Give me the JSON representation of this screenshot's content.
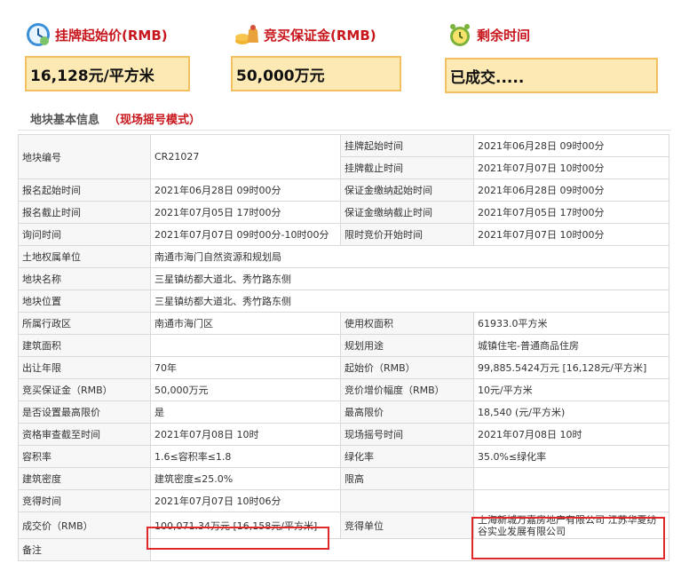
{
  "summary": {
    "start_price": {
      "label": "挂牌起始价(RMB)",
      "value": "16,128元/平方米",
      "icon": "clock-money-icon"
    },
    "deposit": {
      "label": "竞买保证金(RMB)",
      "value": "50,000万元",
      "icon": "coins-bag-icon"
    },
    "remaining": {
      "label": "剩余时间",
      "value": "已成交.....",
      "icon": "alarm-clock-icon"
    }
  },
  "section": {
    "title": "地块基本信息",
    "mode": "（现场摇号模式）"
  },
  "table": {
    "r0": {
      "k1": "地块编号",
      "v1": "CR21027",
      "k2a": "挂牌起始时间",
      "v2a": "2021年06月28日 09时00分",
      "k2b": "挂牌截止时间",
      "v2b": "2021年07月07日 10时00分"
    },
    "r1": {
      "k1": "报名起始时间",
      "v1": "2021年06月28日 09时00分",
      "k2": "保证金缴纳起始时间",
      "v2": "2021年06月28日 09时00分"
    },
    "r2": {
      "k1": "报名截止时间",
      "v1": "2021年07月05日 17时00分",
      "k2": "保证金缴纳截止时间",
      "v2": "2021年07月05日 17时00分"
    },
    "r3": {
      "k1": "询问时间",
      "v1": "2021年07月07日 09时00分-10时00分",
      "k2": "限时竞价开始时间",
      "v2": "2021年07月07日 10时00分"
    },
    "r4": {
      "k1": "土地权属单位",
      "v1": "南通市海门自然资源和规划局"
    },
    "r5": {
      "k1": "地块名称",
      "v1": "三星镇纺都大道北、秀竹路东侧"
    },
    "r6": {
      "k1": "地块位置",
      "v1": "三星镇纺都大道北、秀竹路东侧"
    },
    "r7": {
      "k1": "所属行政区",
      "v1": "南通市海门区",
      "k2": "使用权面积",
      "v2": "61933.0平方米"
    },
    "r8": {
      "k1": "建筑面积",
      "v1": "",
      "k2": "规划用途",
      "v2": "城镇住宅-普通商品住房"
    },
    "r9": {
      "k1": "出让年限",
      "v1": "70年",
      "k2": "起始价（RMB）",
      "v2": "99,885.5424万元 [16,128元/平方米]"
    },
    "r10": {
      "k1": "竞买保证金（RMB）",
      "v1": "50,000万元",
      "k2": "竞价增价幅度（RMB）",
      "v2": "10元/平方米"
    },
    "r11": {
      "k1": "是否设置最高限价",
      "v1": "是",
      "k2": "最高限价",
      "v2": "18,540 (元/平方米)"
    },
    "r12": {
      "k1": "资格审查截至时间",
      "v1": "2021年07月08日 10时",
      "k2": "现场摇号时间",
      "v2": "2021年07月08日 10时"
    },
    "r13": {
      "k1": "容积率",
      "v1": "1.6≤容积率≤1.8",
      "k2": "绿化率",
      "v2": "35.0%≤绿化率"
    },
    "r14": {
      "k1": "建筑密度",
      "v1": "建筑密度≤25.0%",
      "k2": "限高",
      "v2": ""
    },
    "r15": {
      "k1": "竞得时间",
      "v1": "2021年07月07日 10时06分"
    },
    "r16": {
      "k1": "成交价（RMB）",
      "v1": "100,071.34万元 [16,158元/平方米]",
      "k2": "竞得单位",
      "v2": "上海新城万嘉房地产有限公司 江苏华夏纺谷实业发展有限公司"
    },
    "r17": {
      "k1": "备注",
      "v1": ""
    }
  },
  "colors": {
    "accent_red": "#c8161d",
    "box_fill": "#fde9b4",
    "box_border": "#f2c061",
    "highlight": "#e0282a"
  }
}
